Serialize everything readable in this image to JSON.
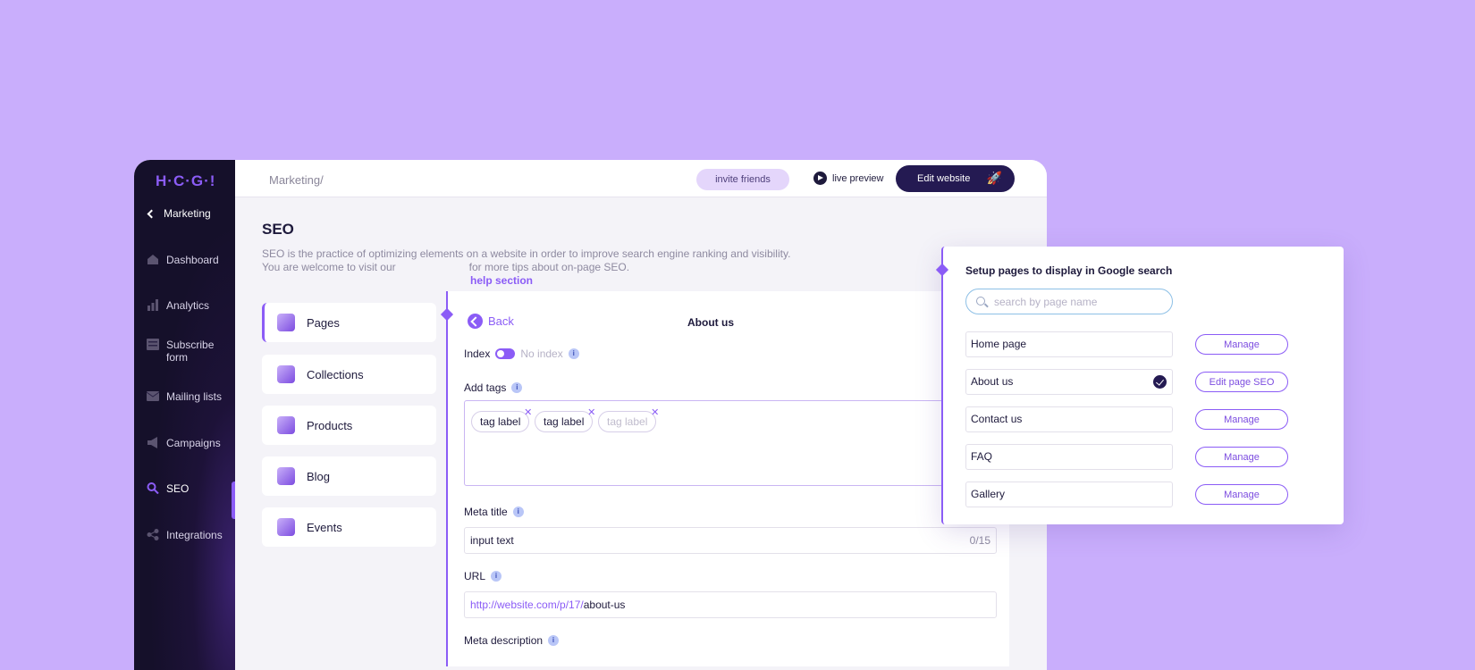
{
  "sidebar": {
    "logo": "H·C·G·!",
    "back_label": "Marketing",
    "items": [
      {
        "label": "Dashboard",
        "icon": "home-icon"
      },
      {
        "label": "Analytics",
        "icon": "bar-chart-icon"
      },
      {
        "label": "Subscribe form",
        "icon": "form-icon"
      },
      {
        "label": "Mailing lists",
        "icon": "mail-icon"
      },
      {
        "label": "Campaigns",
        "icon": "megaphone-icon"
      },
      {
        "label": "SEO",
        "icon": "search-icon"
      },
      {
        "label": "Integrations",
        "icon": "share-icon"
      }
    ]
  },
  "topbar": {
    "breadcrumb": "Marketing/",
    "invite_label": "invite friends",
    "live_label": "live preview",
    "edit_label": "Edit website",
    "rocket_icon": "rocket-icon"
  },
  "page": {
    "title": "SEO",
    "desc_line1": "SEO is the practice of optimizing elements on a website in order to improve search engine ranking and visibility.",
    "desc_line2": "You are welcome to visit our",
    "desc_line2b": "for more tips about on-page SEO.",
    "help_link": "help section"
  },
  "categories": [
    {
      "label": "Pages"
    },
    {
      "label": "Collections"
    },
    {
      "label": "Products"
    },
    {
      "label": "Blog"
    },
    {
      "label": "Events"
    }
  ],
  "editor": {
    "back_label": "Back",
    "title": "About us",
    "index_label": "Index",
    "noindex_label": "No index",
    "tags_label": "Add tags",
    "tags": [
      "tag label",
      "tag label"
    ],
    "tag_placeholder": "tag label",
    "meta_title_label": "Meta title",
    "meta_title_value": "input text",
    "meta_title_counter": "0/15",
    "url_label": "URL",
    "url_prefix": "http://website.com/p/17/",
    "url_slug": "about-us",
    "meta_desc_label": "Meta description"
  },
  "google_card": {
    "title": "Setup pages to display in Google search",
    "search_placeholder": "search by page name",
    "pages": [
      {
        "name": "Home page",
        "action": "Manage"
      },
      {
        "name": "About us",
        "action": "Edit page SEO"
      },
      {
        "name": "Contact us",
        "action": "Manage"
      },
      {
        "name": "FAQ",
        "action": "Manage"
      },
      {
        "name": "Gallery",
        "action": "Manage"
      }
    ]
  },
  "colors": {
    "background": "#c9aefc",
    "accent": "#8b5cf6",
    "dark": "#241a52"
  }
}
